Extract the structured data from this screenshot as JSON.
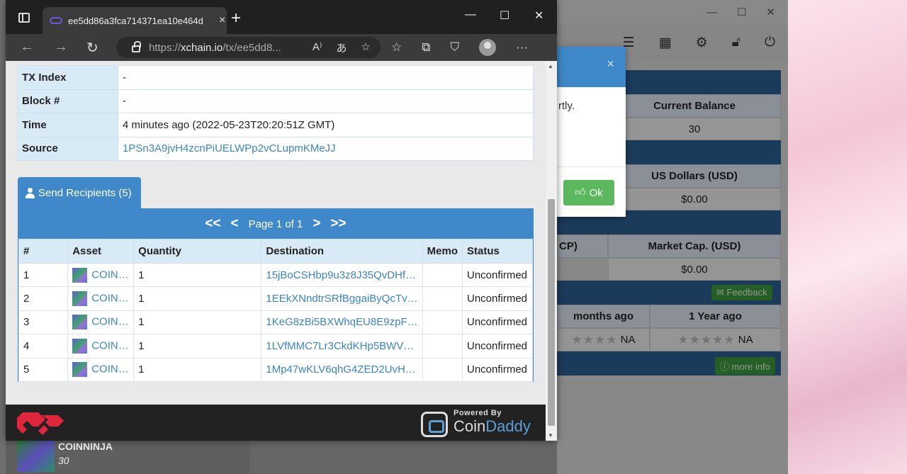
{
  "browser": {
    "tab_title": "ee5dd86a3fca714371ea10e464d",
    "tab_close": "×",
    "new_tab": "+",
    "minimize": "—",
    "maximize": "☐",
    "close": "✕",
    "url_prefix": "https://",
    "url_domain": "xchain.io",
    "url_path": "/tx/ee5dd8..."
  },
  "tx_info": [
    {
      "key": "TX Index",
      "value": "-"
    },
    {
      "key": "Block #",
      "value": "-"
    },
    {
      "key": "Time",
      "value": "4 minutes ago (2022-05-23T20:20:51Z GMT)"
    },
    {
      "key": "Source",
      "value": "1PSn3A9jvH4zcnPiUELWPp2vCLupmKMeJJ"
    }
  ],
  "send_tab": {
    "label": "Send Recipients (5)"
  },
  "pager": {
    "first": "<<",
    "prev": "<",
    "text": "Page 1 of 1",
    "next": ">",
    "last": ">>"
  },
  "recipients": {
    "headers": [
      "#",
      "Asset",
      "Quantity",
      "Destination",
      "Memo",
      "Status"
    ],
    "rows": [
      {
        "n": "1",
        "asset": "COIN…",
        "qty": "1",
        "dest": "15jBoCSHbp9u3z8J35QvDHf…",
        "memo": "",
        "status": "Unconfirmed"
      },
      {
        "n": "2",
        "asset": "COIN…",
        "qty": "1",
        "dest": "1EEkXNndtrSRfBggaiByQcTv…",
        "memo": "",
        "status": "Unconfirmed"
      },
      {
        "n": "3",
        "asset": "COIN…",
        "qty": "1",
        "dest": "1KeG8zBi5BXWhqEU8E9zpF…",
        "memo": "",
        "status": "Unconfirmed"
      },
      {
        "n": "4",
        "asset": "COIN…",
        "qty": "1",
        "dest": "1LVfMMC7Lr3CkdKHp5BWV…",
        "memo": "",
        "status": "Unconfirmed"
      },
      {
        "n": "5",
        "asset": "COIN…",
        "qty": "1",
        "dest": "1Mp47wKLV6qhG4ZED2UvH…",
        "memo": "",
        "status": "Unconfirmed"
      }
    ]
  },
  "footer": {
    "powered_by": "Powered By",
    "brand_a": "Coin",
    "brand_b": "Daddy"
  },
  "background": {
    "modal_text": "rtly.",
    "modal_close": "×",
    "ok_label": "Ok",
    "current_balance_label": "Current Balance",
    "current_balance_value": "30",
    "usd_label": "US Dollars (USD)",
    "usd_value": "$0.00",
    "xcp_label": "CP)",
    "market_cap_label": "Market Cap. (USD)",
    "market_cap_value": "$0.00",
    "feedback_label": "Feedback",
    "months_ago_label": "months ago",
    "year_ago_label": "1 Year ago",
    "na_a": "NA",
    "na_b": "NA",
    "more_info_label": "more info",
    "asset_name": "COINNINJA",
    "asset_qty": "30"
  }
}
